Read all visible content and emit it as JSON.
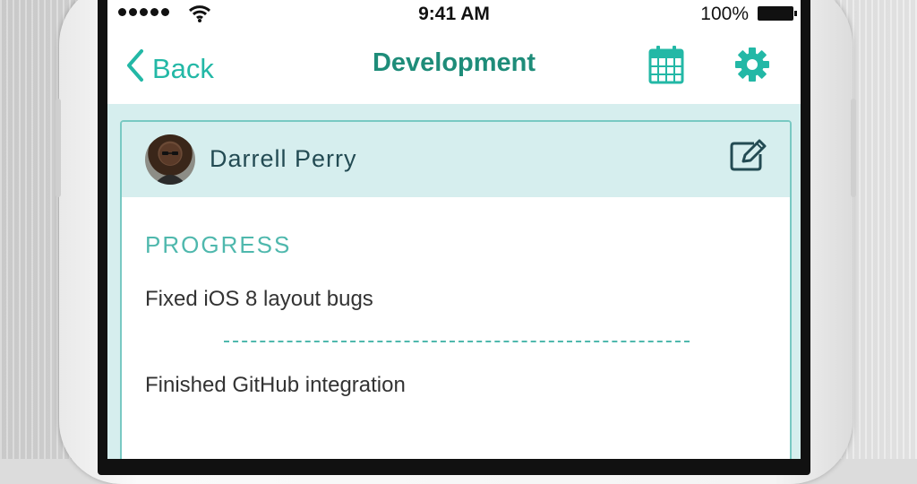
{
  "status_bar": {
    "time": "9:41 AM",
    "battery": "100%"
  },
  "nav": {
    "back_label": "Back",
    "title": "Development",
    "icons": [
      "chevron-left-icon",
      "calendar-icon",
      "gear-icon"
    ]
  },
  "card": {
    "user_name": "Darrell Perry",
    "section_title": "PROGRESS",
    "entries": [
      "Fixed iOS 8 layout bugs",
      "Finished GitHub integration"
    ],
    "icons": [
      "avatar",
      "edit-icon"
    ]
  },
  "colors": {
    "accent": "#23b8a6",
    "title": "#1e8c79",
    "header_bg": "#d6eeee",
    "card_border": "#79c9c3"
  }
}
